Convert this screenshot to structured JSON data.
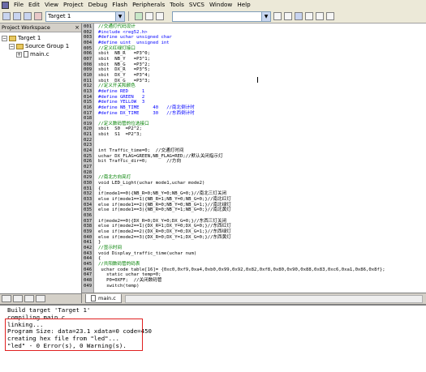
{
  "menu": [
    "File",
    "Edit",
    "View",
    "Project",
    "Debug",
    "Flash",
    "Peripherals",
    "Tools",
    "SVCS",
    "Window",
    "Help"
  ],
  "toolbar": {
    "target": "Target 1"
  },
  "workspace": {
    "title": "Project Workspace",
    "close": "×",
    "tree": {
      "target": "Target 1",
      "group": "Source Group 1",
      "file": "main.c"
    }
  },
  "editor": {
    "lines": [
      {
        "n": "001",
        "t": "//交通灯代码设计",
        "c": "cmt"
      },
      {
        "n": "002",
        "t": "#include <reg52.h>",
        "c": "kw"
      },
      {
        "n": "003",
        "t": "#define uchar unsigned char",
        "c": "kw"
      },
      {
        "n": "004",
        "t": "#define uint  unsigned int",
        "c": "kw"
      },
      {
        "n": "005",
        "t": "//定义红绿灯接口",
        "c": "cmt"
      },
      {
        "n": "006",
        "t": "sbit  NB_R   =P3^0;",
        "c": ""
      },
      {
        "n": "007",
        "t": "sbit  NB_Y   =P3^1;",
        "c": ""
      },
      {
        "n": "008",
        "t": "sbit  NB_G   =P3^2;",
        "c": ""
      },
      {
        "n": "009",
        "t": "sbit  DX_R   =P3^5;",
        "c": ""
      },
      {
        "n": "010",
        "t": "sbit  DX_Y   =P3^4;",
        "c": ""
      },
      {
        "n": "011",
        "t": "sbit  DX_G   =P3^3;",
        "c": ""
      },
      {
        "n": "012",
        "t": "//定义开关和颜色",
        "c": "cmt"
      },
      {
        "n": "013",
        "t": "#define RED     1",
        "c": "kw"
      },
      {
        "n": "014",
        "t": "#define GREEN   2",
        "c": "kw"
      },
      {
        "n": "015",
        "t": "#define YELLOW  3",
        "c": "kw"
      },
      {
        "n": "016",
        "t": "#define NB_TIME     40   //南北倒计时",
        "c": "kw"
      },
      {
        "n": "017",
        "t": "#define DX_TIME     30   //东西倒计时",
        "c": "kw"
      },
      {
        "n": "018",
        "t": "",
        "c": ""
      },
      {
        "n": "019",
        "t": "//定义数码管的位选接口",
        "c": "cmt"
      },
      {
        "n": "020",
        "t": "sbit  S0  =P2^2;",
        "c": ""
      },
      {
        "n": "021",
        "t": "sbit  S1  =P2^3;",
        "c": ""
      },
      {
        "n": "022",
        "t": "",
        "c": ""
      },
      {
        "n": "023",
        "t": "",
        "c": ""
      },
      {
        "n": "024",
        "t": "int Traffic_time=0;  //交通灯时间",
        "c": ""
      },
      {
        "n": "025",
        "t": "uchar DX_FLAG=GREEN,NB_FLAG=RED;//默认关闭指示灯",
        "c": ""
      },
      {
        "n": "026",
        "t": "bit Traffic_dir=0;       //方向",
        "c": ""
      },
      {
        "n": "027",
        "t": "",
        "c": ""
      },
      {
        "n": "028",
        "t": "",
        "c": ""
      },
      {
        "n": "029",
        "t": "//南北方向亮灯",
        "c": "cmt"
      },
      {
        "n": "030",
        "t": "void LED_Light(uchar mode1,uchar mode2)",
        "c": ""
      },
      {
        "n": "031",
        "t": "{",
        "c": ""
      },
      {
        "n": "032",
        "t": "if(mode1==0){NB_R=0;NB_Y=0;NB_G=0;}//南北三灯关闭",
        "c": ""
      },
      {
        "n": "033",
        "t": "else if(mode1==1){NB_R=1;NB_Y=0;NB_G=0;}//南北红灯",
        "c": ""
      },
      {
        "n": "034",
        "t": "else if(mode1==2){NB_R=0;NB_Y=0;NB_G=1;}//南北绿灯",
        "c": ""
      },
      {
        "n": "035",
        "t": "else if(mode1==3){NB_R=0;NB_Y=1;NB_G=0;}//南北黄灯",
        "c": ""
      },
      {
        "n": "036",
        "t": "",
        "c": ""
      },
      {
        "n": "037",
        "t": "if(mode2==0){DX_R=0;DX_Y=0;DX_G=0;}//东西三灯关闭",
        "c": ""
      },
      {
        "n": "038",
        "t": "else if(mode2==1){DX_R=1;DX_Y=0;DX_G=0;}//东西红灯",
        "c": ""
      },
      {
        "n": "039",
        "t": "else if(mode2==2){DX_R=0;DX_Y=0;DX_G=1;}//东西绿灯",
        "c": ""
      },
      {
        "n": "040",
        "t": "else if(mode2==3){DX_R=0;DX_Y=1;DX_G=0;}//东西黄灯",
        "c": ""
      },
      {
        "n": "041",
        "t": "}",
        "c": ""
      },
      {
        "n": "042",
        "t": "//显示时间",
        "c": "cmt"
      },
      {
        "n": "043",
        "t": "void Display_traffic_time(uchar num)",
        "c": ""
      },
      {
        "n": "044",
        "t": "{",
        "c": ""
      },
      {
        "n": "045",
        "t": "//共阳数码管的码表",
        "c": "cmt"
      },
      {
        "n": "046",
        "t": " uchar code table[16]= {0xc0,0xf9,0xa4,0xb0,0x99,0x92,0x82,0xf8,0x80,0x90,0x88,0x83,0xc6,0xa1,0x86,0x8f};",
        "c": ""
      },
      {
        "n": "047",
        "t": "   static uchar temp=0;",
        "c": ""
      },
      {
        "n": "048",
        "t": "   P0=0XFF;  //关闭数码管",
        "c": ""
      },
      {
        "n": "049",
        "t": "   switch(temp)",
        "c": ""
      }
    ],
    "tab": "main.c"
  },
  "output": {
    "lines": [
      "Build target 'Target 1'",
      "compiling main.c...",
      "linking...",
      "Program Size: data=23.1 xdata=0 code=450",
      "creating hex file from \"led\"...",
      "\"led\" - 0 Error(s), 0 Warning(s)."
    ],
    "highlight_color": "#e02020"
  }
}
